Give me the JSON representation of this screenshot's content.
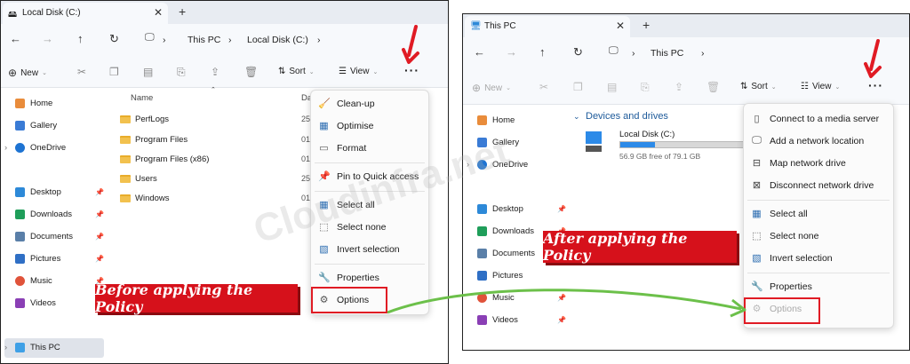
{
  "left": {
    "tab_title": "Local Disk (C:)",
    "breadcrumb": [
      "This PC",
      "Local Disk (C:)"
    ],
    "toolbar": {
      "new_label": "New",
      "sort_label": "Sort",
      "view_label": "View"
    },
    "sidebar": [
      {
        "label": "Home",
        "icon": "home-icon"
      },
      {
        "label": "Gallery",
        "icon": "gallery-icon"
      },
      {
        "label": "OneDrive",
        "icon": "onedrive-icon"
      },
      {
        "label": "Desktop",
        "icon": "desktop-icon"
      },
      {
        "label": "Downloads",
        "icon": "downloads-icon"
      },
      {
        "label": "Documents",
        "icon": "documents-icon"
      },
      {
        "label": "Pictures",
        "icon": "pictures-icon"
      },
      {
        "label": "Music",
        "icon": "music-icon"
      },
      {
        "label": "Videos",
        "icon": "videos-icon"
      },
      {
        "label": "This PC",
        "icon": "pc-icon"
      }
    ],
    "name_header": "Name",
    "date_header": "Da",
    "files": [
      {
        "name": "PerfLogs",
        "date": "25,"
      },
      {
        "name": "Program Files",
        "date": "01,"
      },
      {
        "name": "Program Files (x86)",
        "date": "01,"
      },
      {
        "name": "Users",
        "date": "25,"
      },
      {
        "name": "Windows",
        "date": "01,"
      }
    ],
    "menu": [
      {
        "label": "Clean-up",
        "icon": "cleanup-icon"
      },
      {
        "label": "Optimise",
        "icon": "optimise-icon"
      },
      {
        "label": "Format",
        "icon": "format-icon"
      },
      {
        "label": "Pin to Quick access",
        "icon": "pin-icon"
      },
      {
        "label": "Select all",
        "icon": "select-all-icon"
      },
      {
        "label": "Select none",
        "icon": "select-none-icon"
      },
      {
        "label": "Invert selection",
        "icon": "invert-selection-icon"
      },
      {
        "label": "Properties",
        "icon": "properties-icon"
      },
      {
        "label": "Options",
        "icon": "options-icon"
      }
    ],
    "banner": "Before applying the Policy"
  },
  "right": {
    "tab_title": "This PC",
    "breadcrumb": [
      "This PC"
    ],
    "toolbar": {
      "new_label": "New",
      "sort_label": "Sort",
      "view_label": "View"
    },
    "section_title": "Devices and drives",
    "drive": {
      "name": "Local Disk (C:)",
      "free_text": "56.9 GB free of 79.1 GB",
      "used_fraction": 0.28
    },
    "sidebar": [
      {
        "label": "Home",
        "icon": "home-icon"
      },
      {
        "label": "Gallery",
        "icon": "gallery-icon"
      },
      {
        "label": "OneDrive",
        "icon": "onedrive-icon"
      },
      {
        "label": "Desktop",
        "icon": "desktop-icon"
      },
      {
        "label": "Downloads",
        "icon": "downloads-icon"
      },
      {
        "label": "Documents",
        "icon": "documents-icon"
      },
      {
        "label": "Pictures",
        "icon": "pictures-icon"
      },
      {
        "label": "Music",
        "icon": "music-icon"
      },
      {
        "label": "Videos",
        "icon": "videos-icon"
      }
    ],
    "menu": [
      {
        "label": "Connect to a media server",
        "icon": "media-server-icon"
      },
      {
        "label": "Add a network location",
        "icon": "network-location-icon"
      },
      {
        "label": "Map network drive",
        "icon": "map-drive-icon"
      },
      {
        "label": "Disconnect network drive",
        "icon": "disconnect-drive-icon"
      },
      {
        "label": "Select all",
        "icon": "select-all-icon"
      },
      {
        "label": "Select none",
        "icon": "select-none-icon"
      },
      {
        "label": "Invert selection",
        "icon": "invert-selection-icon"
      },
      {
        "label": "Properties",
        "icon": "properties-icon"
      },
      {
        "label": "Options",
        "icon": "options-icon"
      }
    ],
    "banner": "After applying the Policy"
  },
  "watermark": "Cloudinfra.net",
  "colors": {
    "accent_red": "#d6111b",
    "green_arrow": "#6cc04a",
    "drive_fill": "#2c8ae8"
  }
}
